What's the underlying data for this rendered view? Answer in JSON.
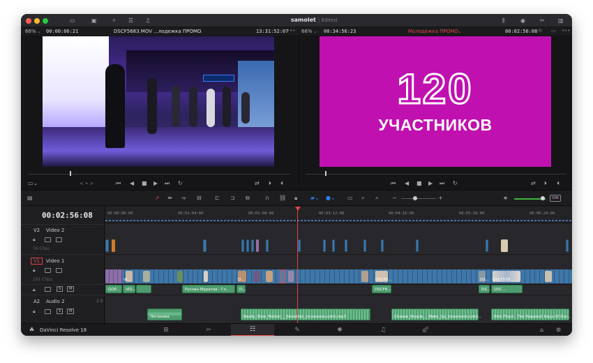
{
  "window": {
    "title": "samolet",
    "status": "Edited"
  },
  "source_viewer": {
    "zoom": "66%",
    "timecode": "00:00:06:21",
    "clip_name": "DSCF5683.MOV ...лодежка ПРОМО",
    "duration": "13:31:52:07",
    "jog": "< • >"
  },
  "record_viewer": {
    "zoom": "66%",
    "timecode": "00:34:56:23",
    "timeline_name": "Молодежка ПРОМО",
    "duration": "00:02:56:08",
    "title_number": "120",
    "title_word": "УЧАСТНИКОВ"
  },
  "timeline": {
    "current_timecode": "00:02:56:08",
    "ruler": [
      "00:00:00:00",
      "00:01:04:00",
      "00:02:08:00",
      "00:03:12:00",
      "00:04:16:00",
      "00:05:20:00",
      "00:06:24:00"
    ],
    "tracks": [
      {
        "id": "V2",
        "name": "Video 2",
        "clips": "76 Clips"
      },
      {
        "id": "V1",
        "name": "Video 1",
        "clips": "291 Clips"
      },
      {
        "id": "A2",
        "name": "Audio 2",
        "level": "2.0"
      }
    ],
    "clip_labels": {
      "v1": [
        "VI...",
        "D...",
        "DSCF6...",
        "DS...",
        "DSCF578..."
      ],
      "a1": [
        "GOP...",
        "VID...",
        "Руслан Муратов - Гл...",
        "D...",
        "DSCF6...",
        "DS...",
        "DSC..."
      ],
      "a2": [
        "Леганива",
        "Really_Slow_Motion_-_Shredder_(musmore.com).mp3",
        "Cheese_People_-_Wake_Up_(musmore.com)...",
        "Pink Floyd - The Happiest Days Of Our..."
      ]
    },
    "audio_toggle": "DIM",
    "button_labels": {
      "mute": "S",
      "solo": "M"
    }
  },
  "bottom_bar": {
    "app_name": "DaVinci Resolve 18",
    "pages": [
      "media",
      "cut",
      "edit",
      "fusion",
      "color",
      "fairlight",
      "deliver"
    ],
    "active_page": "edit"
  },
  "colors": {
    "accent_red": "#e04545",
    "video_clip": "#3f77a8",
    "audio_clip": "#4e9b6e",
    "title_bg": "#c010b0"
  }
}
